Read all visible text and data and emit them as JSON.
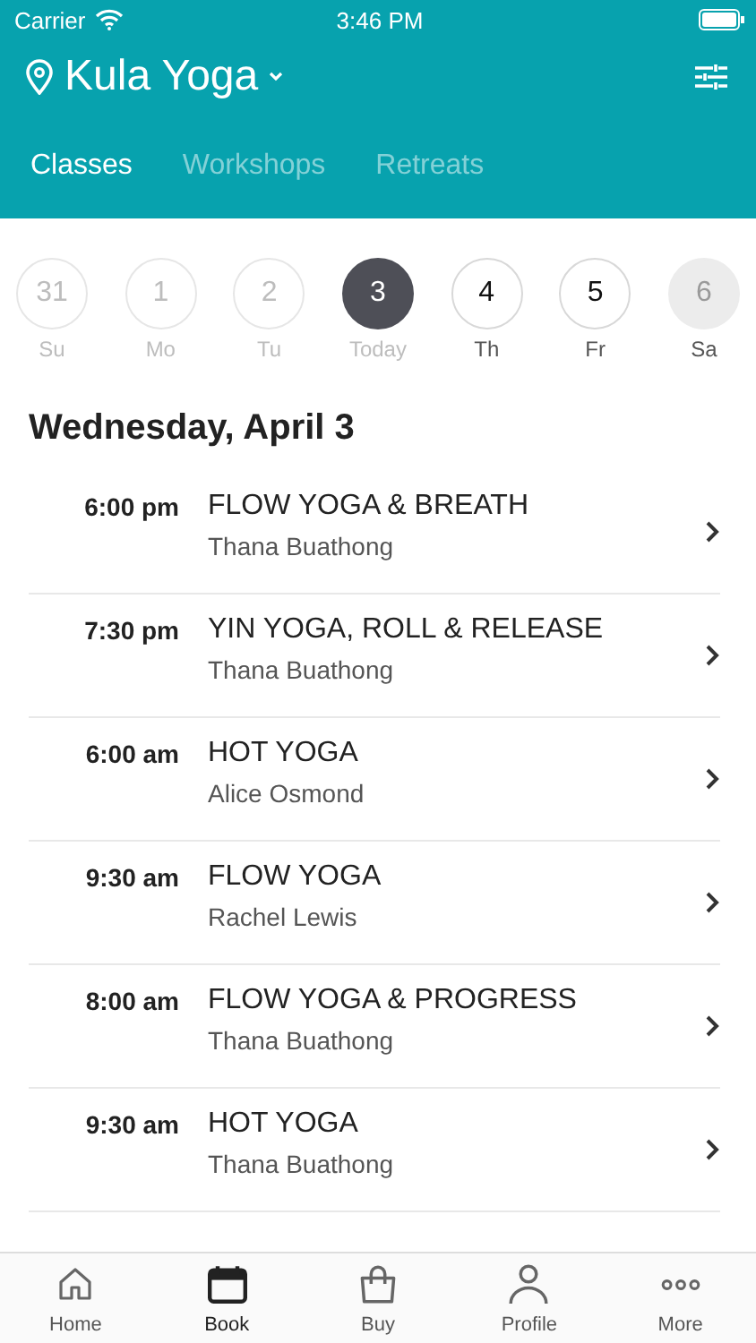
{
  "status_bar": {
    "carrier": "Carrier",
    "time": "3:46 PM"
  },
  "header": {
    "studio": "Kula Yoga"
  },
  "tabs": [
    {
      "label": "Classes",
      "selected": true
    },
    {
      "label": "Workshops",
      "selected": false
    },
    {
      "label": "Retreats",
      "selected": false
    }
  ],
  "days": [
    {
      "date": "31",
      "label": "Su",
      "kind": "past",
      "selected": false
    },
    {
      "date": "1",
      "label": "Mo",
      "kind": "past",
      "selected": false
    },
    {
      "date": "2",
      "label": "Tu",
      "kind": "past",
      "selected": false
    },
    {
      "date": "3",
      "label": "Today",
      "kind": "past",
      "selected": true
    },
    {
      "date": "4",
      "label": "Th",
      "kind": "future",
      "selected": false
    },
    {
      "date": "5",
      "label": "Fr",
      "kind": "future",
      "selected": false
    },
    {
      "date": "6",
      "label": "Sa",
      "kind": "unavailable",
      "selected": false
    }
  ],
  "day_heading": "Wednesday, April 3",
  "classes": [
    {
      "time": "6:00 pm",
      "name": "FLOW YOGA & BREATH",
      "teacher": "Thana Buathong"
    },
    {
      "time": "7:30 pm",
      "name": "YIN YOGA, ROLL & RELEASE",
      "teacher": "Thana Buathong"
    },
    {
      "time": "6:00 am",
      "name": "HOT YOGA",
      "teacher": "Alice Osmond"
    },
    {
      "time": "9:30 am",
      "name": "FLOW YOGA",
      "teacher": "Rachel Lewis"
    },
    {
      "time": "8:00 am",
      "name": "FLOW YOGA & PROGRESS",
      "teacher": "Thana Buathong"
    },
    {
      "time": "9:30 am",
      "name": "HOT YOGA",
      "teacher": "Thana Buathong"
    }
  ],
  "tab_bar": [
    {
      "label": "Home",
      "selected": false
    },
    {
      "label": "Book",
      "selected": true
    },
    {
      "label": "Buy",
      "selected": false
    },
    {
      "label": "Profile",
      "selected": false
    },
    {
      "label": "More",
      "selected": false
    }
  ]
}
